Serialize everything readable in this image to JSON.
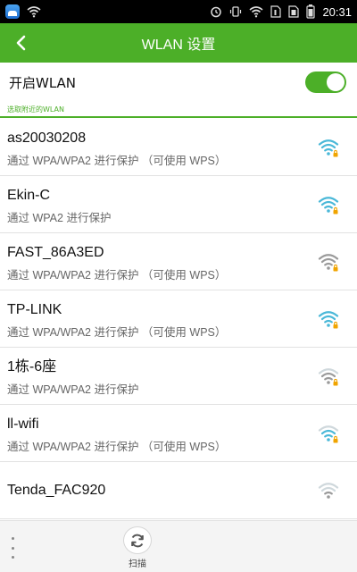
{
  "status_bar": {
    "time": "20:31",
    "icons": [
      "app-icon",
      "wifi-icon",
      "alarm-icon",
      "vibrate-icon",
      "wifi-icon",
      "sim1-icon",
      "sim2-icon",
      "battery-icon"
    ]
  },
  "app_bar": {
    "title": "WLAN 设置",
    "back_icon": "back-arrow-icon"
  },
  "toggle": {
    "label": "开启WLAN",
    "on": true
  },
  "section": {
    "label": "选取附近的WLAN"
  },
  "networks": [
    {
      "name": "as20030208",
      "security": "通过 WPA/WPA2 进行保护 （可使用 WPS）",
      "secured": true,
      "signal": "strong",
      "color": "#4ab8d8"
    },
    {
      "name": "Ekin-C",
      "security": "通过 WPA2 进行保护",
      "secured": true,
      "signal": "strong",
      "color": "#4ab8d8"
    },
    {
      "name": "FAST_86A3ED",
      "security": "通过 WPA/WPA2 进行保护 （可使用 WPS）",
      "secured": true,
      "signal": "strong",
      "color": "#9a9a9a"
    },
    {
      "name": "TP-LINK",
      "security": "通过 WPA/WPA2 进行保护 （可使用 WPS）",
      "secured": true,
      "signal": "strong",
      "color": "#4ab8d8"
    },
    {
      "name": "1栋-6座",
      "security": "通过 WPA/WPA2 进行保护",
      "secured": true,
      "signal": "medium",
      "color": "#9a9a9a"
    },
    {
      "name": "ll-wifi",
      "security": "通过 WPA/WPA2 进行保护 （可使用 WPS）",
      "secured": true,
      "signal": "medium",
      "color": "#4ab8d8"
    },
    {
      "name": "Tenda_FAC920",
      "security": "",
      "secured": false,
      "signal": "weak",
      "color": "#9a9a9a"
    }
  ],
  "bottom_bar": {
    "more_icon": "more-vertical-icon",
    "scan_icon": "refresh-icon",
    "scan_label": "扫描"
  },
  "colors": {
    "accent": "#4caf28",
    "wifi_blue": "#4ab8d8",
    "wifi_gray": "#9a9a9a",
    "lock": "#f0a400"
  }
}
